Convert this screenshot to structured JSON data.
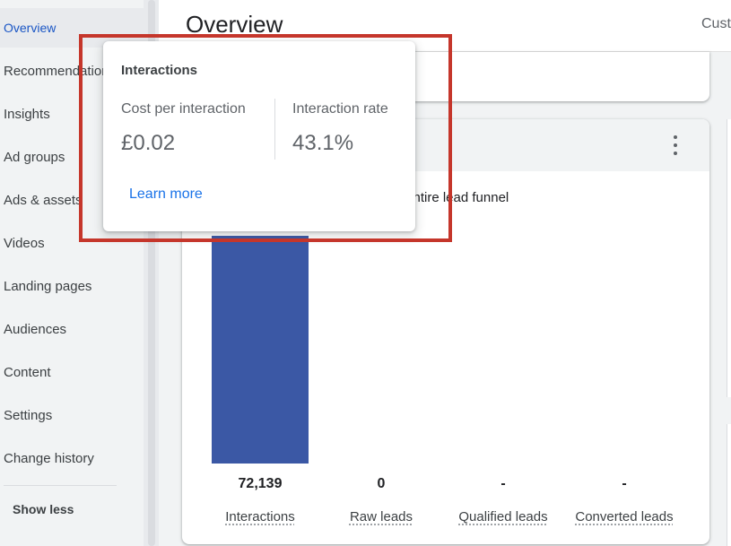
{
  "sidebar": {
    "items": [
      {
        "label": "Overview",
        "active": true
      },
      {
        "label": "Recommendations",
        "active": false
      },
      {
        "label": "Insights",
        "active": false
      },
      {
        "label": "Ad groups",
        "active": false
      },
      {
        "label": "Ads & assets",
        "active": false
      },
      {
        "label": "Videos",
        "active": false
      },
      {
        "label": "Landing pages",
        "active": false
      },
      {
        "label": "Audiences",
        "active": false
      },
      {
        "label": "Content",
        "active": false
      },
      {
        "label": "Settings",
        "active": false
      },
      {
        "label": "Change history",
        "active": false
      }
    ],
    "show_less": "Show less"
  },
  "header": {
    "title": "Overview",
    "right_text": "Cust"
  },
  "card": {
    "chart_title": "r entire lead funnel",
    "more_icon": "more-vert-icon"
  },
  "tooltip": {
    "title": "Interactions",
    "metric1_label": "Cost per interaction",
    "metric1_value": "£0.02",
    "metric2_label": "Interaction rate",
    "metric2_value": "43.1%",
    "link": "Learn more"
  },
  "colors": {
    "bar": "#3b58a5",
    "highlight": "#c5362b",
    "link": "#1a73e8",
    "active_nav": "#1a56c5"
  },
  "chart_data": {
    "type": "bar",
    "categories": [
      "Interactions",
      "Raw leads",
      "Qualified leads",
      "Converted leads"
    ],
    "values": [
      72139,
      0,
      null,
      null
    ],
    "value_labels": [
      "72,139",
      "0",
      "-",
      "-"
    ],
    "ylim": [
      0,
      72139
    ]
  }
}
